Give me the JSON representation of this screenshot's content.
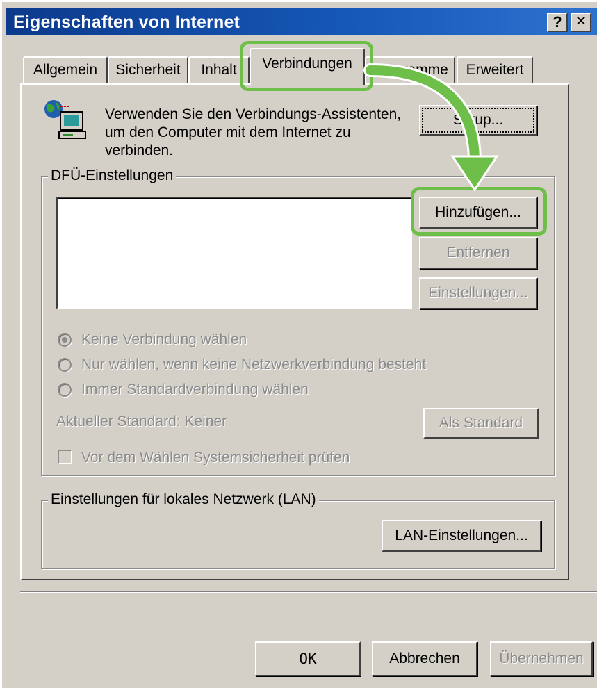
{
  "window": {
    "title": "Eigenschaften von Internet",
    "help_button": "?",
    "close_button": "✕"
  },
  "tabs": [
    {
      "label": "Allgemein",
      "active": false
    },
    {
      "label": "Sicherheit",
      "active": false
    },
    {
      "label": "Inhalt",
      "active": false
    },
    {
      "label": "Verbindungen",
      "active": true
    },
    {
      "label": "Programme",
      "active": false
    },
    {
      "label": "Erweitert",
      "active": false
    }
  ],
  "wizard": {
    "icon": "computer-globe-icon",
    "text_line1": "Verwenden Sie den Verbindungs-Assistenten,",
    "text_line2": "um den Computer mit dem Internet zu",
    "text_line3": "verbinden.",
    "setup_button": "Setup..."
  },
  "dialup": {
    "group_label": "DFÜ-Einstellungen",
    "add_button": "Hinzufügen...",
    "remove_button": "Entfernen",
    "settings_button": "Einstellungen...",
    "radio_options": [
      {
        "label": "Keine Verbindung wählen",
        "checked": true
      },
      {
        "label": "Nur wählen, wenn keine Netzwerkverbindung besteht",
        "checked": false
      },
      {
        "label": "Immer Standardverbindung wählen",
        "checked": false
      }
    ],
    "current_default_label": "Aktueller Standard:",
    "current_default_value": "Keiner",
    "set_default_button": "Als Standard",
    "security_check_label": "Vor dem Wählen Systemsicherheit prüfen",
    "security_check_checked": false
  },
  "lan": {
    "group_label": "Einstellungen für lokales Netzwerk (LAN)",
    "lan_settings_button": "LAN-Einstellungen..."
  },
  "footer": {
    "ok_button": "OK",
    "cancel_button": "Abbrechen",
    "apply_button": "Übernehmen"
  },
  "colors": {
    "titlebar": "#0c3a8c",
    "dialog_face": "#d4d0c8",
    "annotation_highlight": "#6dbf4a"
  }
}
